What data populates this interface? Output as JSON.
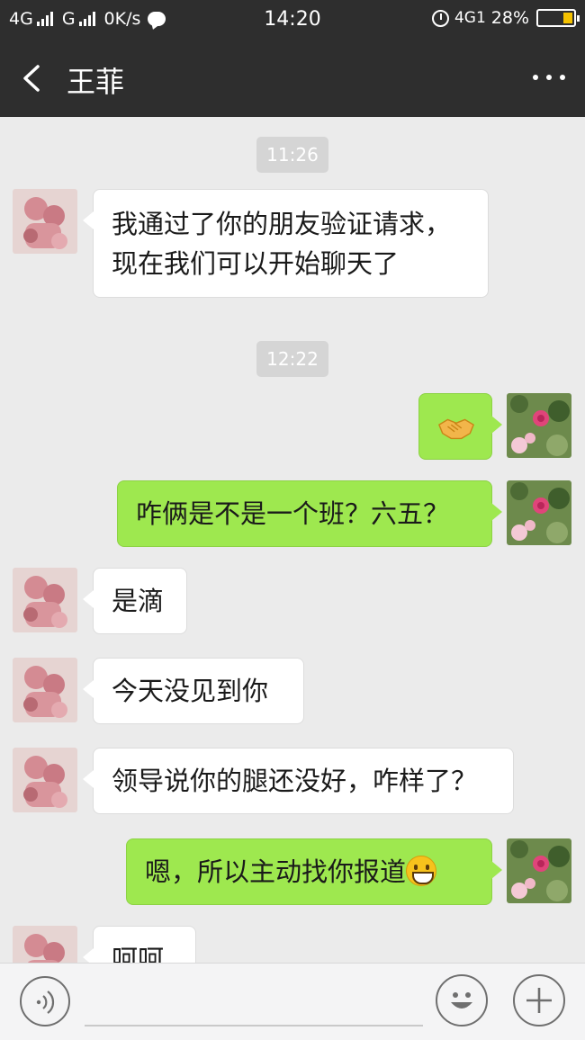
{
  "status_bar": {
    "network1": "4G",
    "network2": "G",
    "speed": "0K/s",
    "time": "14:20",
    "network3": "4G1",
    "battery": "28%"
  },
  "header": {
    "title": "王菲",
    "back_icon": "chevron-left-icon",
    "more_icon": "more-dots-icon"
  },
  "messages": [
    {
      "type": "timestamp",
      "text": "11:26"
    },
    {
      "type": "incoming",
      "lines": [
        "我通过了你的朋友验证请求，",
        "现在我们可以开始聊天了"
      ]
    },
    {
      "type": "timestamp",
      "text": "12:22"
    },
    {
      "type": "outgoing",
      "text": "",
      "emoji": "handshake-emoji"
    },
    {
      "type": "outgoing",
      "text": "咋俩是不是一个班？六五？"
    },
    {
      "type": "incoming",
      "text": "是滴"
    },
    {
      "type": "incoming",
      "text": "今天没见到你"
    },
    {
      "type": "incoming",
      "text": "领导说你的腿还没好，咋样了？"
    },
    {
      "type": "outgoing",
      "text": "嗯，所以主动找你报道",
      "emoji": "grin-emoji"
    },
    {
      "type": "incoming",
      "text": "呵呵"
    }
  ],
  "input_bar": {
    "voice_icon": "voice-icon",
    "emoji_icon": "emoji-icon",
    "plus_icon": "plus-icon"
  },
  "colors": {
    "header_bg": "#2e2e2e",
    "chat_bg": "#ebebeb",
    "outgoing_bubble": "#9ee84f",
    "incoming_bubble": "#ffffff"
  }
}
